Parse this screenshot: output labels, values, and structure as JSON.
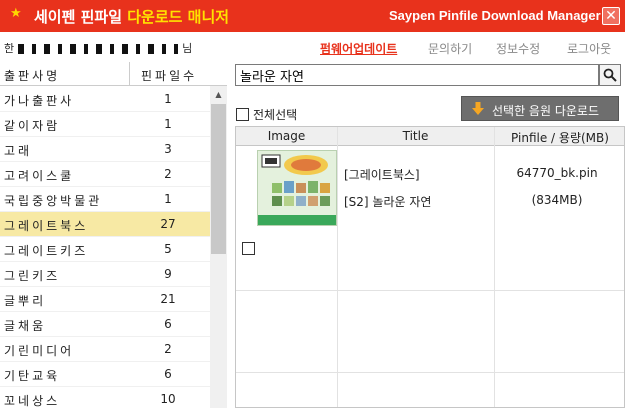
{
  "titlebar": {
    "title_part1": "세이펜 핀파일 ",
    "title_part2": "다운로드 매니저",
    "title_en": "Saypen Pinfile Download Manager",
    "close_icon": "close-icon",
    "accent": "#e8321c",
    "highlight": "#ffe100"
  },
  "user": {
    "prefix": "한",
    "suffix": "님"
  },
  "nav": {
    "update": "펌웨어업데이트",
    "inquiry": "문의하기",
    "account": "정보수정",
    "logout": "로그아웃"
  },
  "publishers": {
    "header_name": "출판사명",
    "header_count": "핀파일수",
    "items": [
      {
        "name": "가나출판사",
        "count": "1"
      },
      {
        "name": "같이자람",
        "count": "1"
      },
      {
        "name": "고래",
        "count": "3"
      },
      {
        "name": "고려이스쿨",
        "count": "2"
      },
      {
        "name": "국립중앙박물관",
        "count": "1"
      },
      {
        "name": "그레이트북스",
        "count": "27",
        "selected": true
      },
      {
        "name": "그레이트키즈",
        "count": "5"
      },
      {
        "name": "그린키즈",
        "count": "9"
      },
      {
        "name": "글뿌리",
        "count": "21"
      },
      {
        "name": "글채움",
        "count": "6"
      },
      {
        "name": "기린미디어",
        "count": "2"
      },
      {
        "name": "기탄교육",
        "count": "6"
      },
      {
        "name": "꼬네상스",
        "count": "10"
      }
    ]
  },
  "search": {
    "value": "놀라운 자연",
    "button_icon": "search-icon"
  },
  "select_all": {
    "label": "전체선택"
  },
  "download": {
    "label": "선택한 음원 다운로드",
    "icon": "down-arrow-icon"
  },
  "table": {
    "headers": {
      "image": "Image",
      "title": "Title",
      "pinfile": "Pinfile / 용량(MB)"
    },
    "rows": [
      {
        "publisher": "[그레이트북스]",
        "title": "[S2] 놀라운 자연",
        "file": "64770_bk.pin",
        "size": "(834MB)"
      }
    ]
  }
}
